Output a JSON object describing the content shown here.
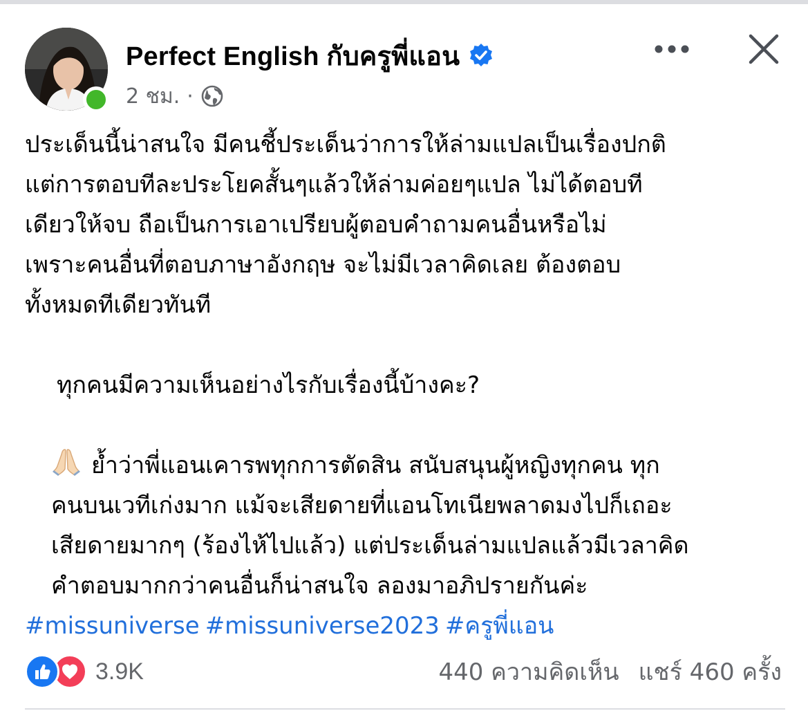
{
  "post": {
    "page_name": "Perfect English กับครูพี่แอน",
    "timestamp": "2 ชม.",
    "separator": "·",
    "privacy_icon": "globe-icon",
    "verified_icon": "verified-badge-icon",
    "paragraph_1": "ประเด็นนี้น่าสนใจ มีคนชี้ประเด็นว่าการให้ล่ามแปลเป็นเรื่องปกติ\nแต่การตอบทีละประโยคสั้นๆแล้วให้ล่ามค่อยๆแปล ไม่ได้ตอบที\nเดียวให้จบ ถือเป็นการเอาเปรียบผู้ตอบคำถามคนอื่นหรือไม่\nเพราะคนอื่นที่ตอบภาษาอังกฤษ จะไม่มีเวลาคิดเลย ต้องตอบ\nทั้งหมดทีเดียวทันที",
    "paragraph_2": "ทุกคนมีความเห็นอย่างไรกับเรื่องนี้บ้างคะ?",
    "paragraph_3": "ย้ำว่าพี่แอนเคารพทุกการตัดสิน สนับสนุนผู้หญิงทุกคน ทุก\nคนบนเวทีเก่งมาก แม้จะเสียดายที่แอนโทเนียพลาดมงไปก็เถอะ\nเสียดายมากๆ (ร้องไห้ไปแล้ว) แต่ประเด็นล่ามแปลแล้วมีเวลาคิด\nคำตอบมากกว่าคนอื่นก็น่าสนใจ ลองมาอภิปรายกันค่ะ",
    "hashtags": [
      "#missuniverse",
      "#missuniverse2023",
      "#ครูพี่แอน"
    ]
  },
  "stats": {
    "reactions_count": "3.9K",
    "comments": "440 ความคิดเห็น",
    "shares": "แชร์ 460 ครั้ง",
    "reaction_icons": [
      "like-icon",
      "love-icon"
    ]
  },
  "colors": {
    "link": "#216fdb",
    "secondary_text": "#65676b",
    "verified": "#1877f2",
    "online": "#42b72a",
    "like": "#1877f2",
    "love": "#f33e58"
  }
}
